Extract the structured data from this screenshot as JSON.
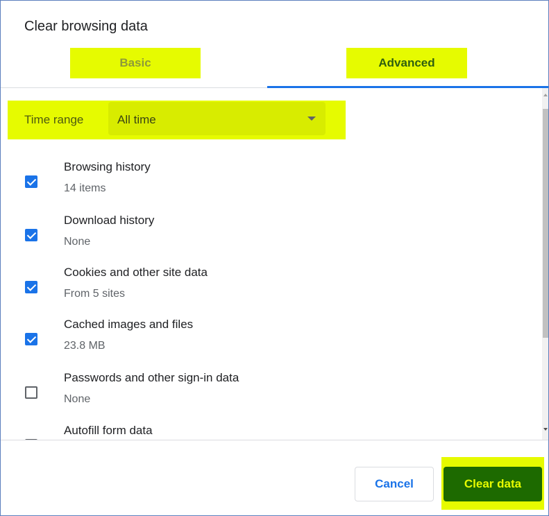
{
  "dialog": {
    "title": "Clear browsing data"
  },
  "tabs": [
    {
      "label": "Basic",
      "selected": false
    },
    {
      "label": "Advanced",
      "selected": true
    }
  ],
  "time_range": {
    "label": "Time range",
    "value": "All time"
  },
  "options": [
    {
      "title": "Browsing history",
      "subtitle": "14 items",
      "checked": true
    },
    {
      "title": "Download history",
      "subtitle": "None",
      "checked": true
    },
    {
      "title": "Cookies and other site data",
      "subtitle": "From 5 sites",
      "checked": true
    },
    {
      "title": "Cached images and files",
      "subtitle": "23.8 MB",
      "checked": true
    },
    {
      "title": "Passwords and other sign-in data",
      "subtitle": "None",
      "checked": false
    },
    {
      "title": "Autofill form data",
      "subtitle": "",
      "checked": false
    }
  ],
  "footer": {
    "cancel_label": "Cancel",
    "clear_label": "Clear data"
  },
  "colors": {
    "highlight": "#e6fb00",
    "accent": "#1a73e8",
    "clear_button": "#1d6a00"
  }
}
